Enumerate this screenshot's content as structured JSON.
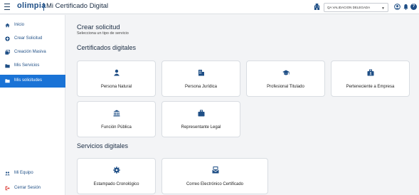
{
  "header": {
    "logo": "olimpia",
    "app_title": "Mi Certificado Digital",
    "entity_select": "QA VALIDACION DELEGADA",
    "help_icon_glyph": "?"
  },
  "sidebar": {
    "items": [
      {
        "label": "Inicio",
        "icon": "home-icon"
      },
      {
        "label": "Crear Solicitud",
        "icon": "plus-circle-icon"
      },
      {
        "label": "Creación Masiva",
        "icon": "stack-icon"
      },
      {
        "label": "Mis Servicios",
        "icon": "folder-icon"
      },
      {
        "label": "Mis solicitudes",
        "icon": "folder-icon",
        "active": true
      }
    ],
    "bottom_items": [
      {
        "label": "Mi Equipo",
        "icon": "team-icon"
      },
      {
        "label": "Cerrar Sesión",
        "icon": "logout-icon"
      }
    ]
  },
  "main": {
    "title": "Crear solicitud",
    "subtitle": "Selecciona un tipo de servicio",
    "cert_section_title": "Certificados digitales",
    "cert_cards": [
      {
        "label": "Persona Natural",
        "icon": "person-icon"
      },
      {
        "label": "Persona Jurídica",
        "icon": "building-icon"
      },
      {
        "label": "Profesional Titulado",
        "icon": "graduation-cap-icon"
      },
      {
        "label": "Perteneciente a Empresa",
        "icon": "briefcase-badge-icon"
      },
      {
        "label": "Función Pública",
        "icon": "government-building-icon"
      },
      {
        "label": "Representante Legal",
        "icon": "briefcase-icon"
      }
    ],
    "services_section_title": "Servicios digitales",
    "service_cards": [
      {
        "label": "Estampado Cronológico",
        "icon": "gear-icon"
      },
      {
        "label": "Correo Electrónico Certificado",
        "icon": "certified-mail-icon"
      }
    ]
  },
  "colors": {
    "brand": "#1f4f86",
    "active": "#1a73d6",
    "background": "#f3f4f6"
  }
}
